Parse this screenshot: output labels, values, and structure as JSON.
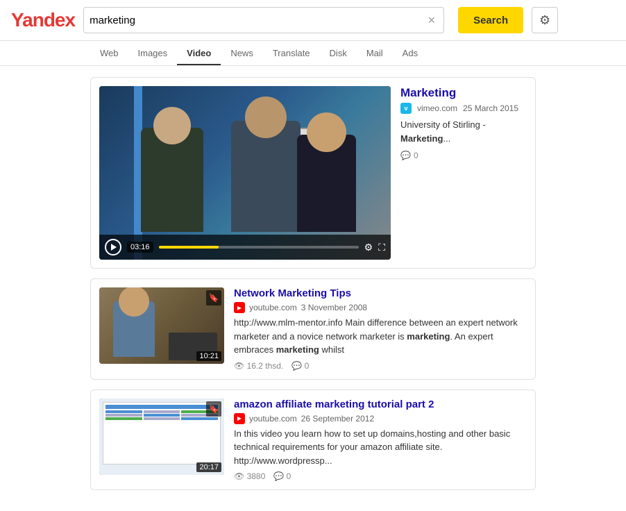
{
  "logo": {
    "prefix": "Y",
    "rest": "andex",
    "accent_color": "#e53935"
  },
  "search": {
    "query": "marketing",
    "placeholder": "Search",
    "button_label": "Search",
    "clear_label": "×"
  },
  "nav": {
    "items": [
      {
        "id": "web",
        "label": "Web",
        "active": false
      },
      {
        "id": "images",
        "label": "Images",
        "active": false
      },
      {
        "id": "video",
        "label": "Video",
        "active": true
      },
      {
        "id": "news",
        "label": "News",
        "active": false
      },
      {
        "id": "translate",
        "label": "Translate",
        "active": false
      },
      {
        "id": "disk",
        "label": "Disk",
        "active": false
      },
      {
        "id": "mail",
        "label": "Mail",
        "active": false
      },
      {
        "id": "ads",
        "label": "Ads",
        "active": false
      }
    ]
  },
  "results": {
    "featured": {
      "title": "Marketing",
      "source": "vimeo.com",
      "date": "25 March 2015",
      "description_prefix": "University of Stirling - ",
      "description_bold": "Marketing",
      "description_suffix": "...",
      "comments": "0",
      "duration": "03:16"
    },
    "items": [
      {
        "title_prefix": "Network ",
        "title_bold": "Marketing",
        "title_suffix": " Tips",
        "source": "youtube.com",
        "date": "3 November 2008",
        "description": "http://www.mlm-mentor.info Main difference between an expert network marketer and a novice network marketer is ",
        "desc_bold1": "marketing",
        "desc_mid": ". An expert embraces ",
        "desc_bold2": "marketing",
        "desc_end": " whilst",
        "views": "16.2 thsd.",
        "comments": "0",
        "duration": "10:21"
      },
      {
        "title_prefix": "amazon affiliate ",
        "title_bold": "marketing",
        "title_suffix": " tutorial part 2",
        "source": "youtube.com",
        "date": "26 September 2012",
        "description": "In this video you learn how to set up domains,hosting and other basic technical requirements for your amazon affiliate site. http://www.wordpressp...",
        "views": "3880",
        "comments": "0",
        "duration": "20:17"
      }
    ]
  }
}
